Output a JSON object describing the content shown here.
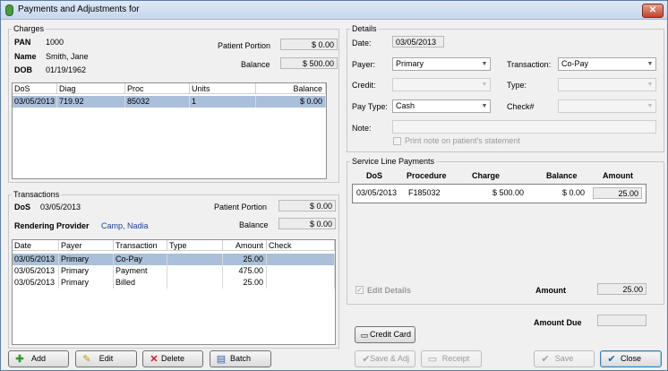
{
  "window": {
    "title": "Payments and Adjustments for",
    "close_label": "✕"
  },
  "charges": {
    "group_title": "Charges",
    "pan_label": "PAN",
    "pan_value": "1000",
    "name_label": "Name",
    "name_value": "Smith, Jane",
    "dob_label": "DOB",
    "dob_value": "01/19/1962",
    "patient_portion_label": "Patient Portion",
    "patient_portion_value": "$ 0.00",
    "balance_label": "Balance",
    "balance_value": "$ 500.00",
    "columns": [
      "DoS",
      "Diag",
      "Proc",
      "Units",
      "Balance"
    ],
    "rows": [
      {
        "dos": "03/05/2013",
        "diag": "719.92",
        "proc": "85032",
        "units": "1",
        "balance": "$ 0.00"
      }
    ]
  },
  "transactions": {
    "group_title": "Transactions",
    "dos_label": "DoS",
    "dos_value": "03/05/2013",
    "patient_portion_label": "Patient Portion",
    "patient_portion_value": "$ 0.00",
    "provider_label": "Rendering Provider",
    "provider_value": "Camp, Nadia",
    "balance_label": "Balance",
    "balance_value": "$ 0.00",
    "columns": [
      "Date",
      "Payer",
      "Transaction",
      "Type",
      "Amount",
      "Check"
    ],
    "rows": [
      {
        "date": "03/05/2013",
        "payer": "Primary",
        "transaction": "Co-Pay",
        "type": "",
        "amount": "25.00",
        "check": ""
      },
      {
        "date": "03/05/2013",
        "payer": "Primary",
        "transaction": "Payment",
        "type": "",
        "amount": "475.00",
        "check": ""
      },
      {
        "date": "03/05/2013",
        "payer": "Primary",
        "transaction": "Billed",
        "type": "",
        "amount": "25.00",
        "check": ""
      }
    ]
  },
  "details": {
    "group_title": "Details",
    "date_label": "Date:",
    "date_value": "03/05/2013",
    "payer_label": "Payer:",
    "payer_value": "Primary",
    "transaction_label": "Transaction:",
    "transaction_value": "Co-Pay",
    "credit_label": "Credit:",
    "credit_value": "",
    "type_label": "Type:",
    "type_value": "",
    "pay_type_label": "Pay Type:",
    "pay_type_value": "Cash",
    "check_label": "Check#",
    "check_value": "",
    "note_label": "Note:",
    "note_value": "",
    "print_note_label": "Print note on patient's statement"
  },
  "service_line": {
    "group_title": "Service Line Payments",
    "columns": [
      "DoS",
      "Procedure",
      "Charge",
      "Balance",
      "Amount"
    ],
    "rows": [
      {
        "dos": "03/05/2013",
        "procedure": "F185032",
        "charge": "$ 500.00",
        "balance": "$ 0.00",
        "amount": "25.00"
      }
    ],
    "edit_details_label": "Edit Details",
    "amount_label": "Amount",
    "amount_value": "25.00"
  },
  "amount_due_label": "Amount Due",
  "amount_due_value": "",
  "buttons": {
    "credit_card": "Credit Card",
    "add": "Add",
    "edit": "Edit",
    "delete": "Delete",
    "batch": "Batch",
    "save_adj": "Save & Adj",
    "receipt": "Receipt",
    "save": "Save",
    "close": "Close"
  }
}
